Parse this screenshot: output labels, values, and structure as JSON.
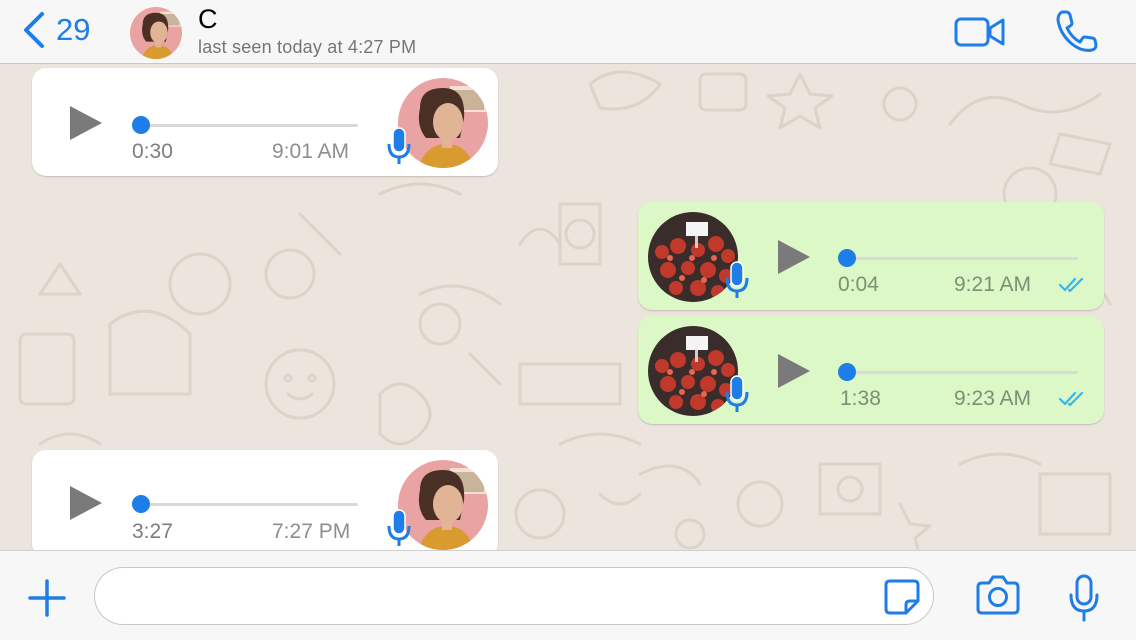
{
  "header": {
    "back_count": "29",
    "contact_name": "C",
    "last_seen": "last seen today at 4:27 PM",
    "icons": [
      "chevron-left-icon",
      "video-call-icon",
      "phone-icon"
    ]
  },
  "messages": [
    {
      "direction": "incoming",
      "type": "voice",
      "duration": "0:30",
      "time": "9:01 AM",
      "progress": 0
    },
    {
      "direction": "outgoing",
      "type": "voice",
      "duration": "0:04",
      "time": "9:21 AM",
      "status": "read",
      "progress": 0
    },
    {
      "direction": "outgoing",
      "type": "voice",
      "duration": "1:38",
      "time": "9:23 AM",
      "status": "read",
      "progress": 0
    },
    {
      "direction": "incoming",
      "type": "voice",
      "duration": "3:27",
      "time": "7:27 PM",
      "progress": 0
    }
  ],
  "composer": {
    "placeholder": "",
    "value": "",
    "icons": [
      "plus-icon",
      "sticker-icon",
      "camera-icon",
      "microphone-icon"
    ]
  },
  "colors": {
    "accent": "#1f7de8",
    "outgoing_bubble": "#dcf8c6",
    "incoming_bubble": "#ffffff",
    "chat_background": "#ece5dd",
    "read_ticks": "#34b7f1"
  }
}
